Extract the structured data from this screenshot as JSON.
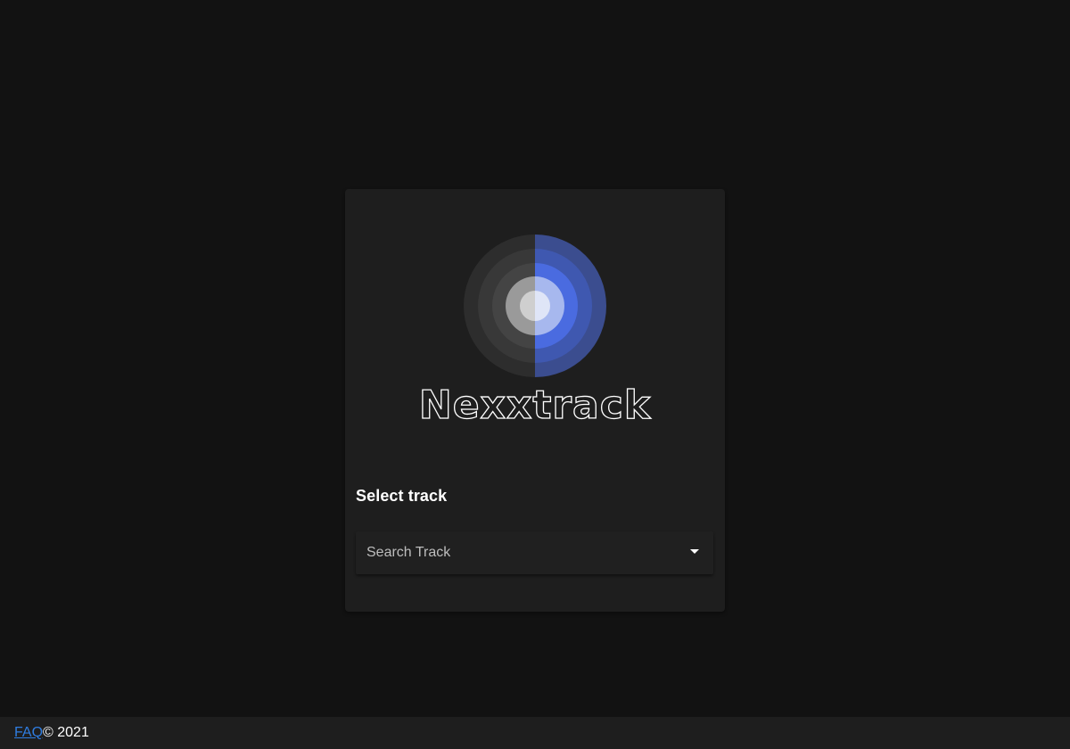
{
  "logo": {
    "brand_name": "Nexxtrack",
    "colors": {
      "ring_left": "#3a3a3a",
      "ring_right": "#3b4d8f",
      "accent_blue": "#4a6be0",
      "center_light": "#d9d9d9"
    }
  },
  "main": {
    "section_title": "Select track",
    "search": {
      "placeholder": "Search Track",
      "value": ""
    }
  },
  "footer": {
    "faq_label": "FAQ",
    "copyright": "© 2021"
  },
  "colors": {
    "background": "#121212",
    "card": "#1e1e1e",
    "link": "#2f7de1"
  }
}
